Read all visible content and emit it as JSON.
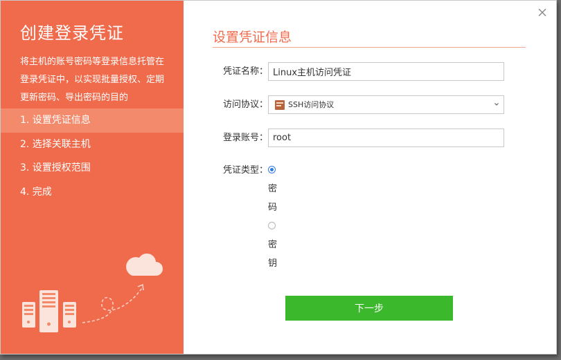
{
  "sidebar": {
    "title": "创建登录凭证",
    "description": "将主机的账号密码等登录信息托管在登录凭证中，以实现批量授权、定期更新密码、导出密码的目的",
    "steps": [
      {
        "label": "1. 设置凭证信息",
        "active": true
      },
      {
        "label": "2. 选择关联主机",
        "active": false
      },
      {
        "label": "3. 设置授权范围",
        "active": false
      },
      {
        "label": "4. 完成",
        "active": false
      }
    ]
  },
  "main": {
    "section_title": "设置凭证信息",
    "fields": {
      "name": {
        "label": "凭证名称：",
        "value": "Linux主机访问凭证"
      },
      "protocol": {
        "label": "访问协议：",
        "value": "SSH访问协议",
        "icon": "ssh-icon"
      },
      "account": {
        "label": "登录账号：",
        "value": "root"
      },
      "type": {
        "label": "凭证类型：",
        "options": [
          {
            "label": "密码",
            "checked": true
          },
          {
            "label": "密钥",
            "checked": false
          }
        ]
      }
    },
    "next_button": "下一步"
  },
  "colors": {
    "sidebar_bg": "#ef6b4b",
    "active_step_bg": "#f38a6c",
    "accent": "#ef6b4b",
    "primary_button": "#3bb82b",
    "radio_checked": "#2f7ae5"
  },
  "icons": [
    "close-icon",
    "chevron-down-icon",
    "cloud-icon",
    "server-icon",
    "upload-arrow-icon"
  ]
}
